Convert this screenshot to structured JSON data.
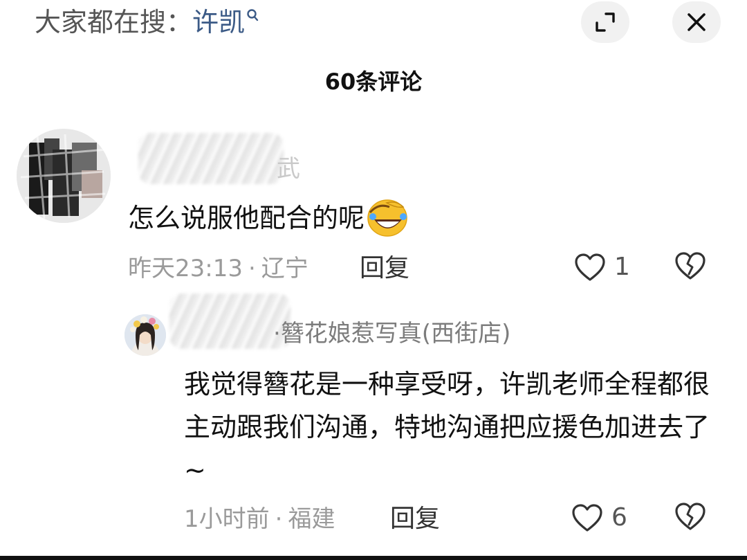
{
  "header": {
    "search_prefix": "大家都在搜：",
    "search_keyword": "许凯",
    "comment_count": "60条评论"
  },
  "comment": {
    "username_suffix": "武",
    "text": "怎么说服他配合的呢",
    "time": "昨天23:13",
    "dot": "·",
    "location": "辽宁",
    "reply_label": "回复",
    "likes": "1"
  },
  "reply": {
    "username": "·簪花娘惹写真(西街店)",
    "text": "我觉得簪花是一种享受呀，许凯老师全程都很主动跟我们沟通，特地沟通把应援色加进去了~",
    "time": "1小时前",
    "dot": "·",
    "location": "福建",
    "reply_label": "回复",
    "likes": "6"
  },
  "icons": {
    "search": "search-icon",
    "expand": "expand-icon",
    "close": "close-icon",
    "like": "heart-icon",
    "dislike": "broken-heart-icon",
    "emoji": "rolling-laughing-emoji"
  },
  "colors": {
    "keyword": "#3b5a86",
    "meta": "#9a9a9a",
    "text": "#111111"
  }
}
